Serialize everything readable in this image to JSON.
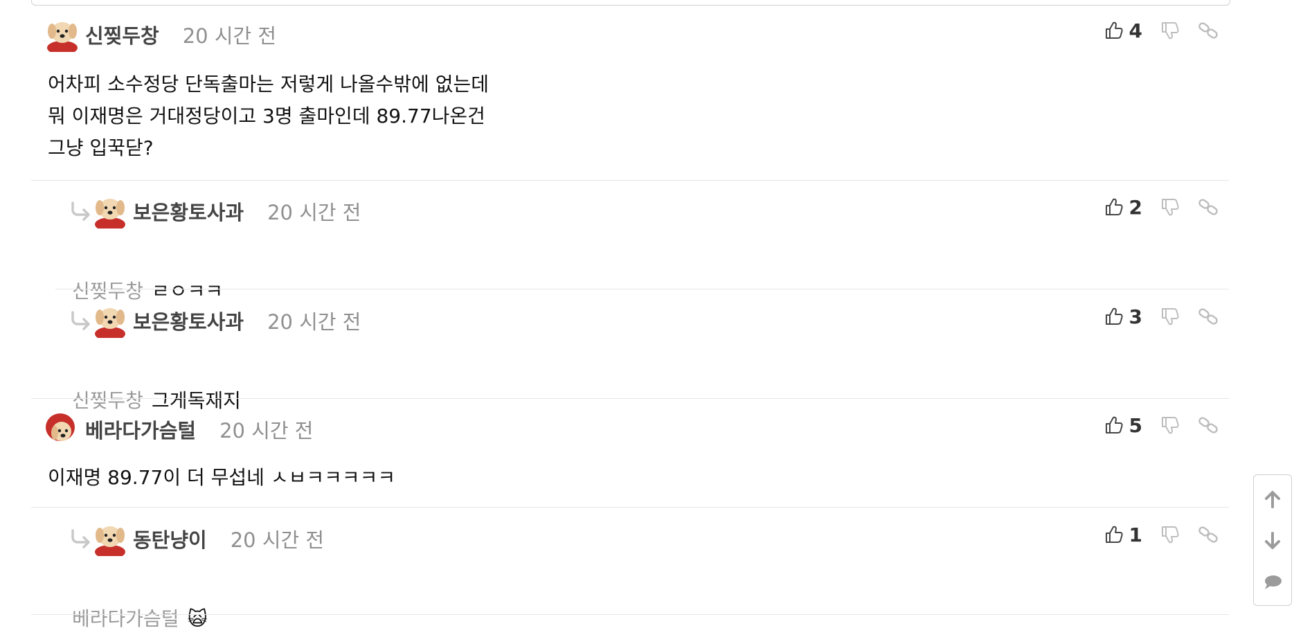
{
  "comments": [
    {
      "author": "신찢두창",
      "time": "20 시간 전",
      "avatar": "puppy-red-cloth",
      "body": "어차피 소수정당 단독출마는 저렇게 나올수밖에 없는데\n뭐 이재명은 거대정당이고 3명 출마인데 89.77나온건\n그냥 입꾹닫?",
      "likes": "4",
      "is_reply": false
    },
    {
      "author": "보은황토사과",
      "time": "20 시간 전",
      "avatar": "puppy-red-cloth",
      "mention": "신찢두창",
      "body": "ㄹㅇㅋㅋ",
      "likes": "2",
      "is_reply": true
    },
    {
      "author": "보은황토사과",
      "time": "20 시간 전",
      "avatar": "puppy-red-cloth",
      "mention": "신찢두창",
      "body": "그게독재지",
      "likes": "3",
      "is_reply": true
    },
    {
      "author": "베라다가슴털",
      "time": "20 시간 전",
      "avatar": "puppy-red-hood",
      "body": "이재명 89.77이 더 무섭네 ㅅㅂㅋㅋㅋㅋㅋ",
      "likes": "5",
      "is_reply": false
    },
    {
      "author": "동탄냥이",
      "time": "20 시간 전",
      "avatar": "puppy-red-cloth",
      "mention": "베라다가슴털",
      "body": "🙀",
      "likes": "1",
      "is_reply": true
    }
  ],
  "icons": {
    "like": "thumbs-up-icon",
    "dislike": "thumbs-down-icon",
    "link": "link-icon",
    "reply_arrow": "reply-arrow-icon",
    "scroll_up": "arrow-up-icon",
    "scroll_down": "arrow-down-icon",
    "comments": "speech-bubble-icon"
  },
  "colors": {
    "author": "#444444",
    "time": "#8f8f8f",
    "mention": "#9a9a9a",
    "divider": "#e6e6e6",
    "icon_gray": "#bdbdbd"
  }
}
